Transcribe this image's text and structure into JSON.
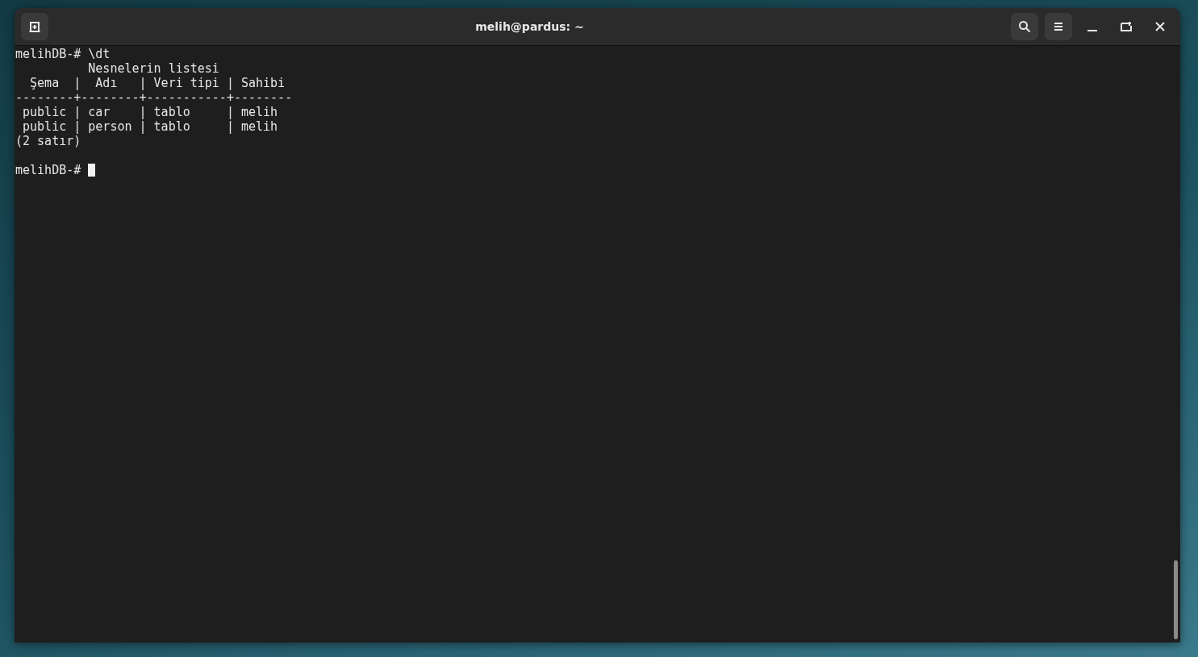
{
  "window": {
    "title": "melih@pardus: ~"
  },
  "terminal": {
    "lines": [
      {
        "kind": "text",
        "text": "melihDB-# \\dt"
      },
      {
        "kind": "text",
        "text": "          Nesnelerin listesi"
      },
      {
        "kind": "text",
        "text": "  Şema  |  Adı   | Veri tipi | Sahibi"
      },
      {
        "kind": "text",
        "text": "--------+--------+-----------+--------"
      },
      {
        "kind": "text",
        "text": " public | car    | tablo     | melih"
      },
      {
        "kind": "text",
        "text": " public | person | tablo     | melih"
      },
      {
        "kind": "text",
        "text": "(2 satır)"
      },
      {
        "kind": "blank"
      },
      {
        "kind": "prompt",
        "text": "melihDB-# "
      }
    ]
  }
}
